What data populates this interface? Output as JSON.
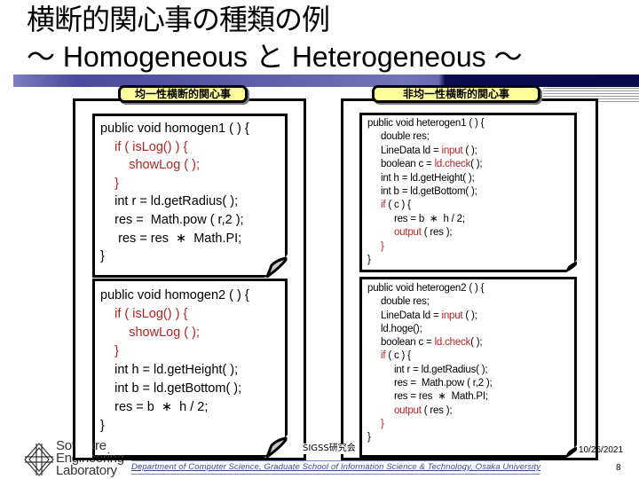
{
  "slide": {
    "title_line1": "横断的関心事の種類の例",
    "title_line2": "～ Homogeneous と Heterogeneous ～",
    "colors": {
      "title_bar_light": "#6a6ab4",
      "title_bar_dark": "#08084a",
      "label_fill": "#ffff99",
      "highlight_code": "#b22222",
      "footer_dept_text": "#3b4a8a"
    }
  },
  "panels": {
    "homogeneous": {
      "label": "均一性横断的関心事",
      "notes": [
        {
          "lines": [
            [
              {
                "t": "public void homogen1 ( ) {"
              }
            ],
            [
              {
                "t": "    "
              },
              {
                "t": "if ( isLog() ) {",
                "hl": true
              }
            ],
            [
              {
                "t": "        "
              },
              {
                "t": "showLog ( );",
                "hl": true
              }
            ],
            [
              {
                "t": "    "
              },
              {
                "t": "}",
                "hl": true
              }
            ],
            [
              {
                "t": "    int r = ld.getRadius( );"
              }
            ],
            [
              {
                "t": "    res =  Math.pow ( r,2 );"
              }
            ],
            [
              {
                "t": "     res = res  ∗  Math.PI;"
              }
            ],
            [
              {
                "t": "}"
              }
            ]
          ]
        },
        {
          "lines": [
            [
              {
                "t": "public void homogen2 ( ) {"
              }
            ],
            [
              {
                "t": "    "
              },
              {
                "t": "if ( isLog() ) {",
                "hl": true
              }
            ],
            [
              {
                "t": "        "
              },
              {
                "t": "showLog ( );",
                "hl": true
              }
            ],
            [
              {
                "t": "    "
              },
              {
                "t": "}",
                "hl": true
              }
            ],
            [
              {
                "t": "    int h = ld.getHeight( );"
              }
            ],
            [
              {
                "t": "    int b = ld.getBottom( );"
              }
            ],
            [
              {
                "t": "    res = b  ∗  h / 2;"
              }
            ],
            [
              {
                "t": "}"
              }
            ]
          ]
        }
      ]
    },
    "heterogeneous": {
      "label": "非均一性横断的関心事",
      "notes": [
        {
          "lines": [
            [
              {
                "t": "public void heterogen1 ( ) {"
              }
            ],
            [
              {
                "t": "     double res;"
              }
            ],
            [
              {
                "t": "     LineData ld = "
              },
              {
                "t": "input",
                "hl": true
              },
              {
                "t": " ( );"
              }
            ],
            [
              {
                "t": "     boolean c = "
              },
              {
                "t": "ld.check",
                "hl": true
              },
              {
                "t": "( );"
              }
            ],
            [
              {
                "t": "     int h = ld.getHeight( );"
              }
            ],
            [
              {
                "t": "     int b = ld.getBottom( );"
              }
            ],
            [
              {
                "t": "     "
              },
              {
                "t": "if",
                "hl": true
              },
              {
                "t": " ( c ) {"
              }
            ],
            [
              {
                "t": "          res = b  ∗  h / 2;"
              }
            ],
            [
              {
                "t": "          "
              },
              {
                "t": "output",
                "hl": true
              },
              {
                "t": " ( res );"
              }
            ],
            [
              {
                "t": "     "
              },
              {
                "t": "}",
                "hl": true
              }
            ],
            [
              {
                "t": "}"
              }
            ]
          ]
        },
        {
          "lines": [
            [
              {
                "t": "public void heterogen2 ( ) {"
              }
            ],
            [
              {
                "t": "     double res;"
              }
            ],
            [
              {
                "t": "     LineData ld = "
              },
              {
                "t": "input",
                "hl": true
              },
              {
                "t": " ( );"
              }
            ],
            [
              {
                "t": "     ld.hoge();"
              }
            ],
            [
              {
                "t": "     boolean c = "
              },
              {
                "t": "ld.check",
                "hl": true
              },
              {
                "t": "( );"
              }
            ],
            [
              {
                "t": "     "
              },
              {
                "t": "if",
                "hl": true
              },
              {
                "t": " ( c ) {"
              }
            ],
            [
              {
                "t": "          int r = ld.getRadius( );"
              }
            ],
            [
              {
                "t": "          res =  Math.pow ( r,2 );"
              }
            ],
            [
              {
                "t": "          res = res  ∗  Math.PI;"
              }
            ],
            [
              {
                "t": "          "
              },
              {
                "t": "output",
                "hl": true
              },
              {
                "t": " ( res );"
              }
            ],
            [
              {
                "t": "     "
              },
              {
                "t": "}",
                "hl": true
              }
            ],
            [
              {
                "t": "}"
              }
            ]
          ]
        }
      ]
    }
  },
  "footer": {
    "logo_lines": [
      "Software",
      "Engineering",
      "Laboratory"
    ],
    "venue": "SIGSS研究会",
    "date": "10/26/2021",
    "department": "Department of Computer Science, Graduate School of Information Science & Technology, Osaka University",
    "page_number": "8"
  }
}
